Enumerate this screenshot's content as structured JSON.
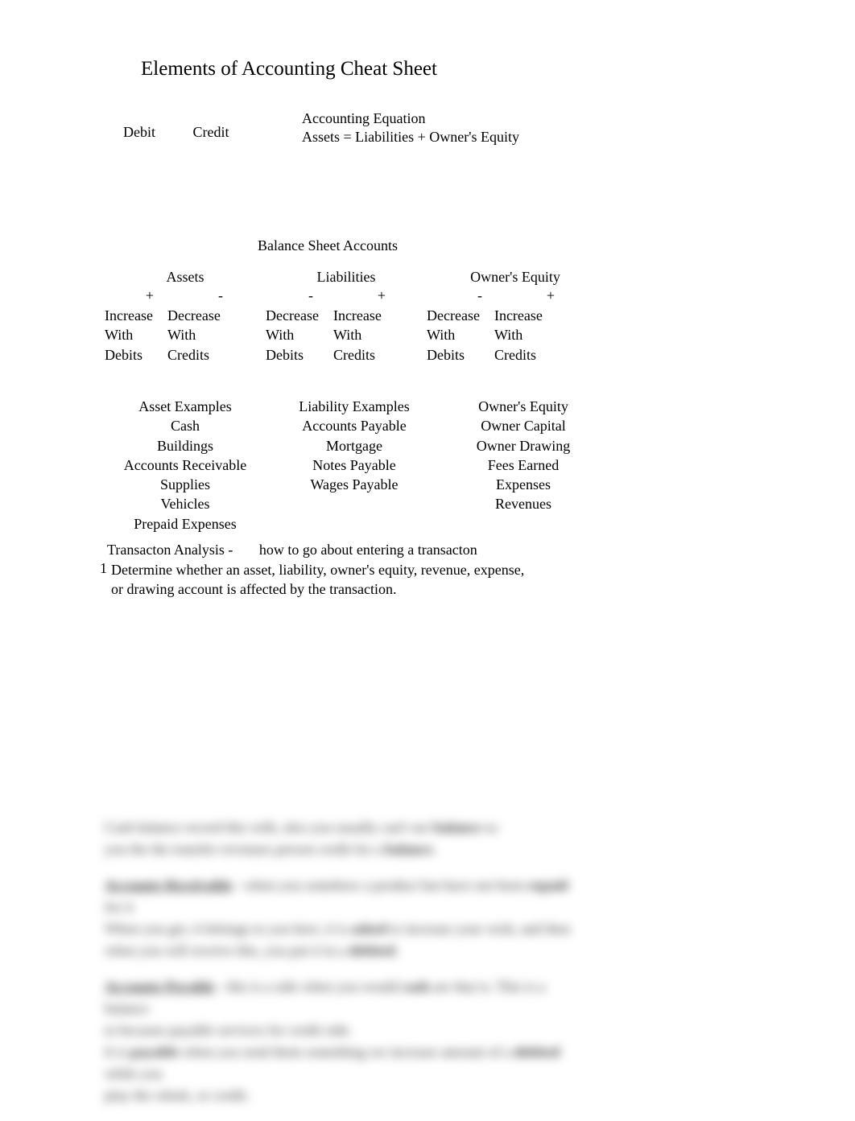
{
  "title": "Elements of Accounting Cheat Sheet",
  "debit_label": "Debit",
  "credit_label": "Credit",
  "equation": {
    "title": "Accounting Equation",
    "formula": "Assets = Liabilities + Owner's Equity"
  },
  "balance_heading": "Balance Sheet Accounts",
  "columns": {
    "assets": {
      "title": "Assets",
      "left_sign": "+",
      "right_sign": "-",
      "left_block": "Increase\nWith\nDebits",
      "right_block": "Decrease\nWith\nCredits"
    },
    "liabilities": {
      "title": "Liabilities",
      "left_sign": "-",
      "right_sign": "+",
      "left_block": "Decrease\nWith\nDebits",
      "right_block": "Increase\nWith\nCredits"
    },
    "equity": {
      "title": "Owner's Equity",
      "left_sign": "-",
      "right_sign": "+",
      "left_block": "Decrease\nWith\nDebits",
      "right_block": "Increase\nWith\nCredits"
    }
  },
  "examples": {
    "assets": {
      "heading": "Asset Examples",
      "items": [
        "Cash",
        "Buildings",
        "Accounts Receivable",
        "Supplies",
        "Vehicles",
        "Prepaid Expenses"
      ]
    },
    "liabilities": {
      "heading": "Liability Examples",
      "items": [
        "Accounts Payable",
        "Mortgage",
        "Notes Payable",
        "Wages Payable"
      ]
    },
    "equity": {
      "heading": "Owner's Equity",
      "items": [
        "Owner Capital",
        "Owner Drawing",
        "Fees Earned",
        "Expenses",
        "Revenues"
      ]
    }
  },
  "transaction": {
    "label": "Transacton Analysis -",
    "subtitle": "how to go about entering a transacton",
    "step_num": "1",
    "step_text": "Determine whether an asset, liability, owner's equity, revenue, expense,\nor drawing account is affected by the transaction."
  },
  "blurred": {
    "p1_a": "Cash balance record this with, also you usually can't see ",
    "p1_b": "balance",
    "p1_c": " so\nyou the the transfer revenues person credit for a ",
    "p1_d": "balance",
    "p1_e": ".",
    "p2_a": "Accounts Receivable",
    "p2_b": " - when you somehow a product but have not been ",
    "p2_c": "repaid",
    "p2_d": " for it\nWhen you get, it belongs to you here, it is ",
    "p2_e": "asked",
    "p2_f": " to increase your wish, and then\nwhen you will receive this, you put it in a ",
    "p2_g": "debited",
    "p2_h": ".",
    "p3_a": "Accounts Payable",
    "p3_b": " - this is a side when you would ",
    "p3_c": "cash",
    "p3_d": " are that is. This is a balance\nto because payable services for credit side.\nIt is ",
    "p3_e": "payable",
    "p3_f": " when you send them something we increase amount of a ",
    "p3_g": "debited",
    "p3_h": " while you\nplay the whole, or credit."
  }
}
